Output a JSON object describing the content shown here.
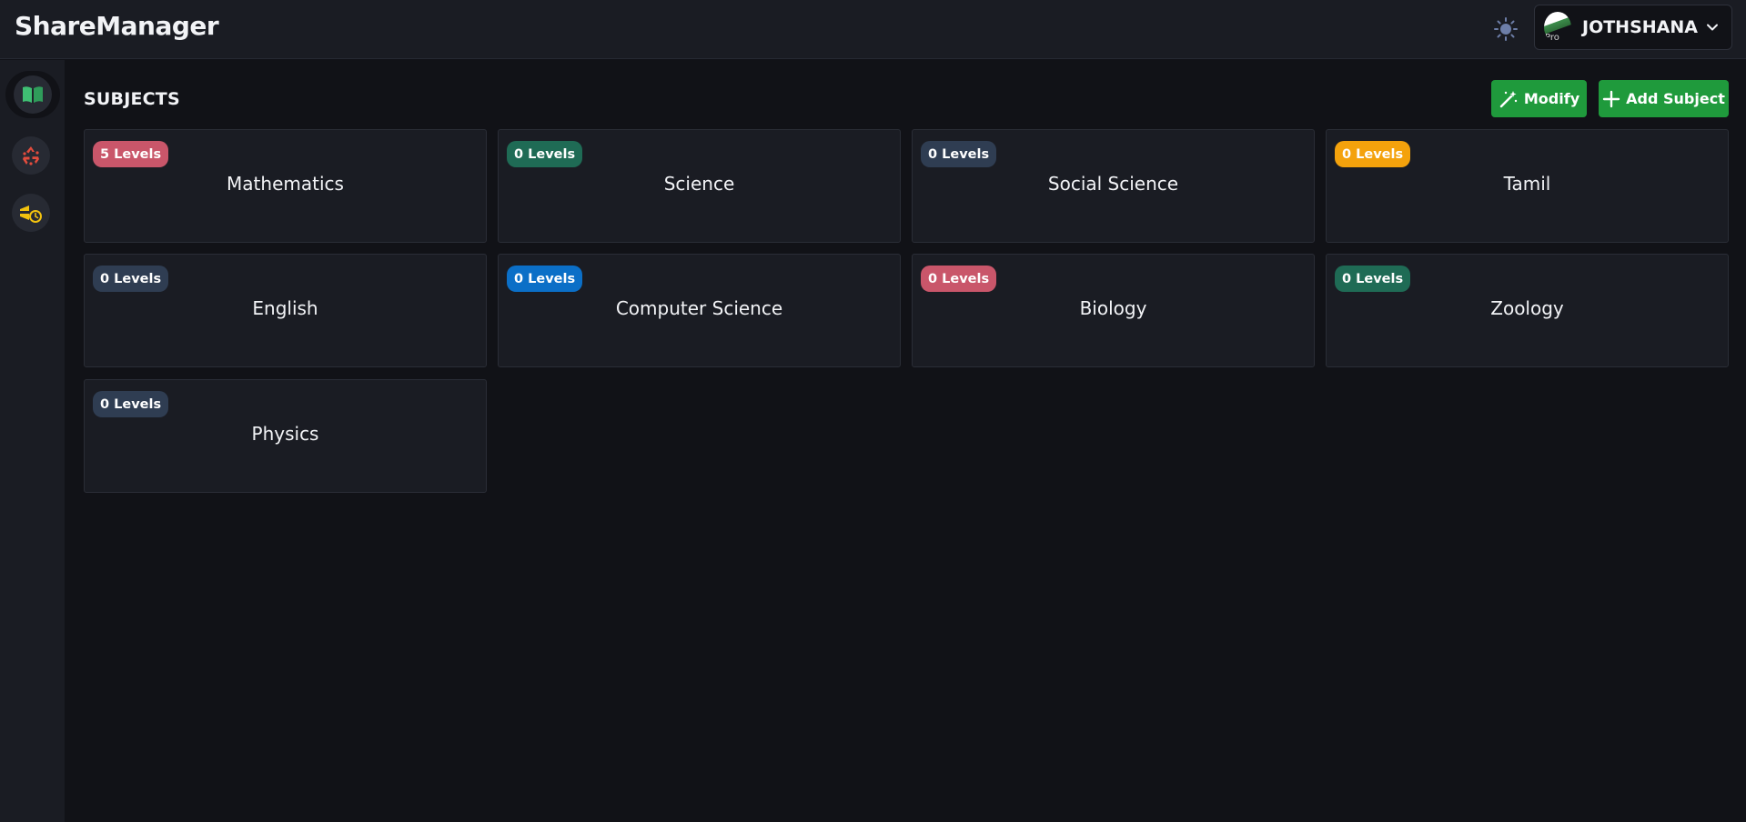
{
  "app": {
    "brand": "ShareManager"
  },
  "user": {
    "name": "JOTHSHANA",
    "avatar_alt": "Pro"
  },
  "page": {
    "title": "SUBJECTS"
  },
  "actions": {
    "modify_label": "Modify",
    "add_label": "Add Subject"
  },
  "sidebar": {
    "items": [
      {
        "name": "subjects",
        "icon": "book-open-icon",
        "active": true
      },
      {
        "name": "recycle",
        "icon": "recycle-icon",
        "active": false
      },
      {
        "name": "history",
        "icon": "history-icon",
        "active": false
      }
    ]
  },
  "colors": {
    "accent": "#1f9a3c",
    "badge_pink": "#c9566a",
    "badge_green": "#1f6b55",
    "badge_slate": "#2f3d52",
    "badge_orange": "#f4a20c",
    "badge_blue": "#0b6fc7"
  },
  "subjects": [
    {
      "name": "Mathematics",
      "levels": "5 Levels",
      "badge_color": "#c9566a"
    },
    {
      "name": "Science",
      "levels": "0 Levels",
      "badge_color": "#1f6b55"
    },
    {
      "name": "Social Science",
      "levels": "0 Levels",
      "badge_color": "#2f3d52"
    },
    {
      "name": "Tamil",
      "levels": "0 Levels",
      "badge_color": "#f4a20c"
    },
    {
      "name": "English",
      "levels": "0 Levels",
      "badge_color": "#2f3d52"
    },
    {
      "name": "Computer Science",
      "levels": "0 Levels",
      "badge_color": "#0b6fc7"
    },
    {
      "name": "Biology",
      "levels": "0 Levels",
      "badge_color": "#c9566a"
    },
    {
      "name": "Zoology",
      "levels": "0 Levels",
      "badge_color": "#1f6b55"
    },
    {
      "name": "Physics",
      "levels": "0 Levels",
      "badge_color": "#2f3d52"
    }
  ]
}
